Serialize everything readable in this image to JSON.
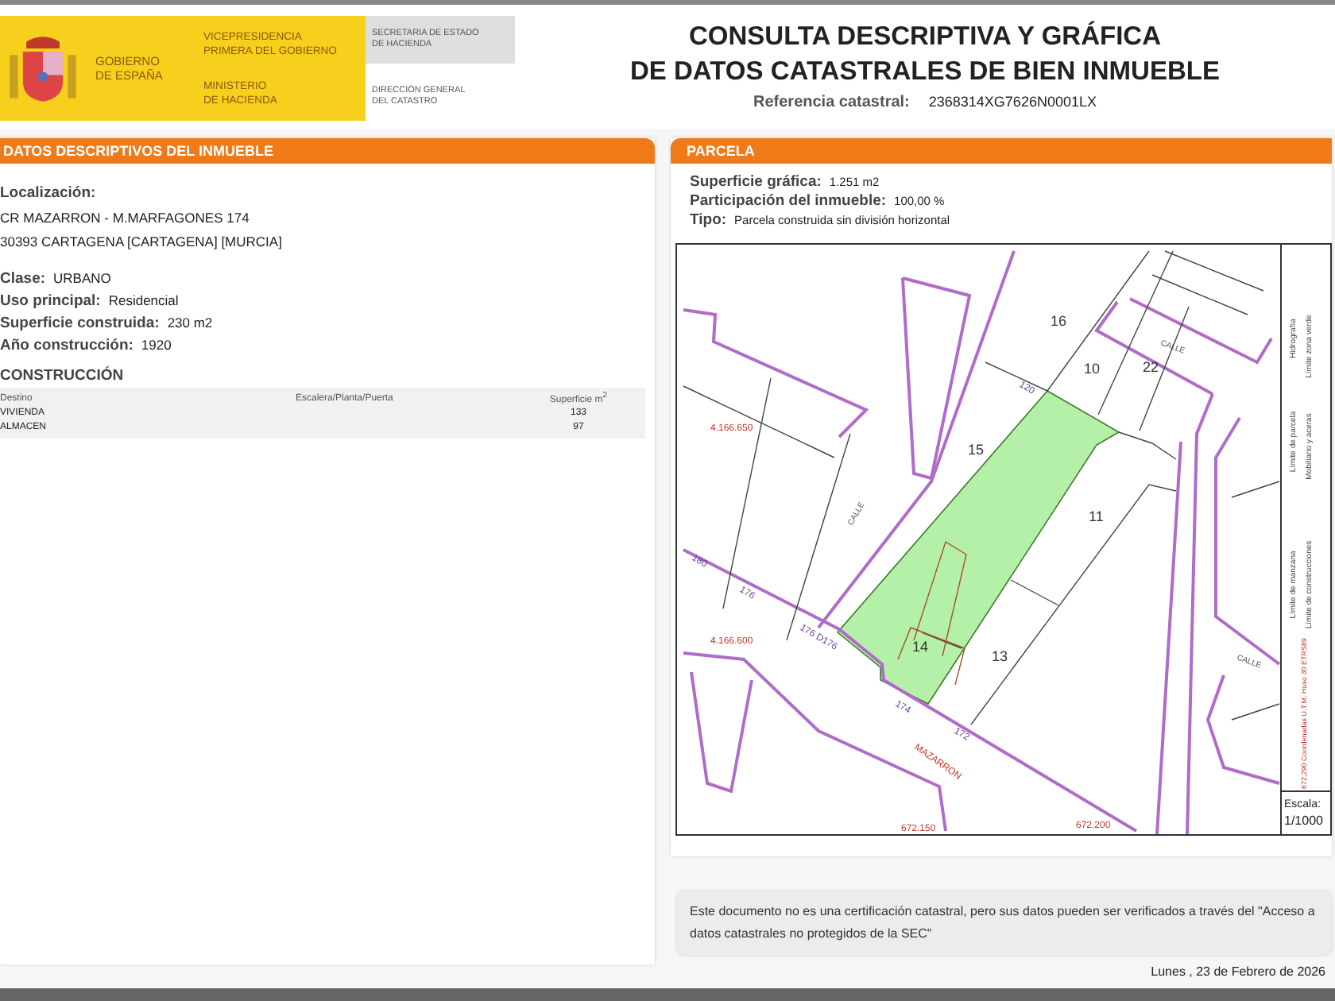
{
  "header": {
    "government": [
      "GOBIERNO",
      "DE ESPAÑA"
    ],
    "vicepresidency": [
      "VICEPRESIDENCIA",
      "PRIMERA DEL GOBIERNO"
    ],
    "ministry": [
      "MINISTERIO",
      "DE HACIENDA"
    ],
    "secretariat": [
      "SECRETARIA DE ESTADO",
      "DE HACIENDA"
    ],
    "directorate": [
      "DIRECCIÓN GENERAL",
      "DEL CATASTRO"
    ],
    "title": [
      "CONSULTA DESCRIPTIVA Y GRÁFICA",
      "DE DATOS CATASTRALES DE BIEN INMUEBLE"
    ],
    "reference_label": "Referencia catastral:",
    "reference_value": "2368314XG7626N0001LX"
  },
  "left_panel": {
    "title": "DATOS DESCRIPTIVOS DEL INMUEBLE",
    "location_label": "Localización:",
    "address": [
      "CR MAZARRON - M.MARFAGONES 174",
      "30393 CARTAGENA [CARTAGENA] [MURCIA]"
    ],
    "fields": [
      {
        "label": "Clase:",
        "value": "URBANO"
      },
      {
        "label": "Uso principal:",
        "value": "Residencial"
      },
      {
        "label": "Superficie construida:",
        "value": "230 m2"
      },
      {
        "label": "Año construcción:",
        "value": "1920"
      }
    ],
    "construction_title": "CONSTRUCCIÓN",
    "table": {
      "columns": [
        "Destino",
        "Escalera/Planta/Puerta",
        "Superficie m$^{2}$"
      ],
      "rows": [
        [
          "VIVIENDA",
          "",
          "133"
        ],
        [
          "ALMACEN",
          "",
          "97"
        ]
      ]
    }
  },
  "right_panel": {
    "title": "PARCELA",
    "fields": [
      {
        "label": "Superficie gráfica:",
        "value": "1.251 m2"
      },
      {
        "label": "Participación del inmueble:",
        "value": "100,00 %"
      },
      {
        "label": "Tipo:",
        "value": "Parcela construida sin división horizontal"
      }
    ],
    "map": {
      "labels": [
        {
          "text": "16",
          "kind": "parcel"
        },
        {
          "text": "10",
          "kind": "parcel"
        },
        {
          "text": "22",
          "kind": "parcel"
        },
        {
          "text": "15",
          "kind": "parcel"
        },
        {
          "text": "11",
          "kind": "parcel"
        },
        {
          "text": "13",
          "kind": "parcel"
        },
        {
          "text": "14",
          "kind": "parcel"
        },
        {
          "text": "CALLE",
          "kind": "street"
        },
        {
          "text": "CALLE",
          "kind": "street"
        },
        {
          "text": "CALLE",
          "kind": "street"
        },
        {
          "text": "MAZARRON",
          "kind": "coordinate"
        },
        {
          "text": "4.166.650",
          "kind": "coordinate"
        },
        {
          "text": "4.166.600",
          "kind": "coordinate"
        },
        {
          "text": "672.150",
          "kind": "coordinate"
        },
        {
          "text": "672.200",
          "kind": "coordinate"
        },
        {
          "text": "120",
          "kind": "number"
        },
        {
          "text": "176 D176",
          "kind": "number"
        },
        {
          "text": "174",
          "kind": "number"
        },
        {
          "text": "172",
          "kind": "number"
        },
        {
          "text": "176",
          "kind": "number"
        },
        {
          "text": "180",
          "kind": "number"
        }
      ],
      "legend": [
        "Hidrografía",
        "Límite de parcela",
        "Límite de manzana",
        "Límite zona verde",
        "Mobiliario y aceras",
        "Límite de construcciones"
      ],
      "coordinates_note": "672,290 Coordenadas U.T.M. Huso 30 ETRS89",
      "scale_label": "Escala:",
      "scale_value": "1/1000"
    }
  },
  "notice": "Este documento no es una certificación catastral, pero sus datos pueden ser verificados a través del \"Acceso a datos catastrales no protegidos de la SEC\"",
  "date": "Lunes , 23 de Febrero de 2026"
}
